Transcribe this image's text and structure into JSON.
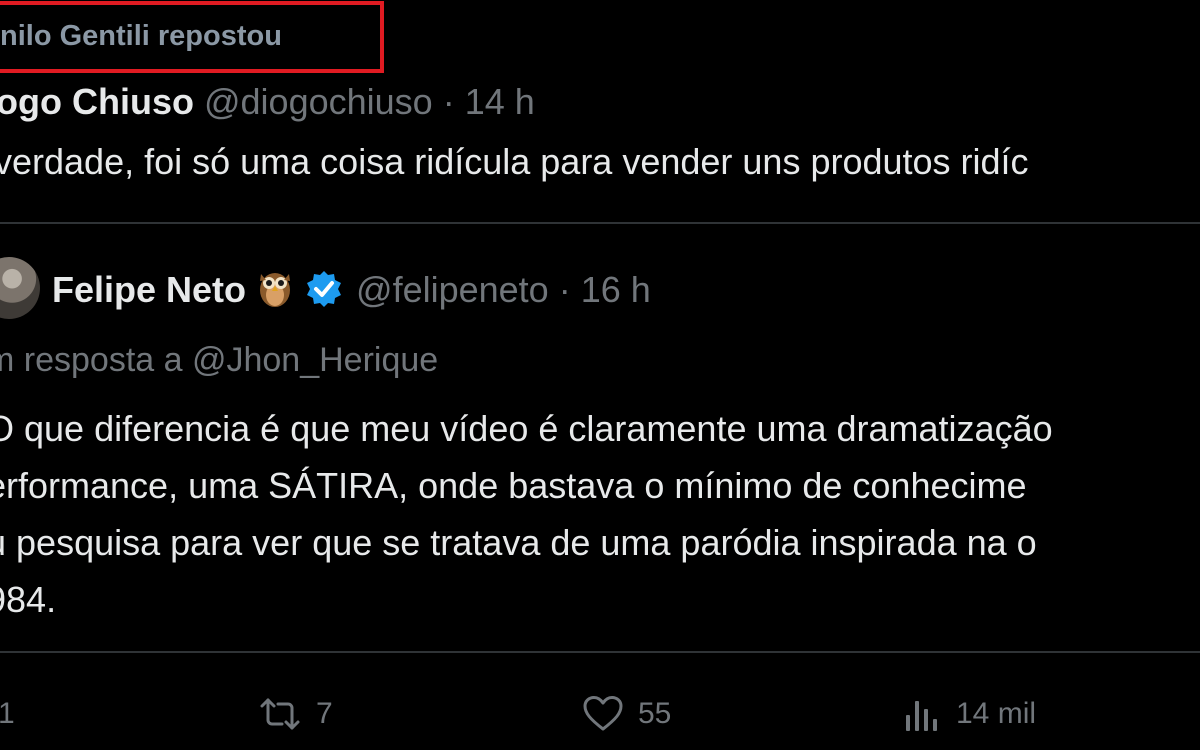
{
  "repost": {
    "text": "nilo Gentili repostou"
  },
  "tweet": {
    "author_name": "ogo Chiuso",
    "author_handle": "@diogochiuso",
    "separator": " · ",
    "time": "14 h",
    "text": "verdade, foi só uma coisa ridícula para vender uns produtos ridíc"
  },
  "quote": {
    "author_name": "Felipe Neto",
    "author_handle": "@felipeneto",
    "separator": " · ",
    "time": "16 h",
    "reply_to": "m resposta a @Jhon_Herique",
    "lines": [
      "O que diferencia é que meu vídeo é claramente uma dramatização",
      "erformance, uma SÁTIRA, onde bastava o mínimo de conhecime",
      "u pesquisa para ver que se tratava de uma paródia inspirada na o",
      "984."
    ]
  },
  "actions": {
    "reply_count": "1",
    "repost_count": "7",
    "like_count": "55",
    "views_count": "14 mil"
  },
  "colors": {
    "background": "#000000",
    "text": "#e7e9ea",
    "muted": "#71767b",
    "highlight_box": "#e01b22",
    "verified": "#1d9bf0"
  },
  "icons": [
    "owl-emoji-icon",
    "verified-badge-icon",
    "reply-icon",
    "repost-icon",
    "like-heart-icon",
    "views-chart-icon"
  ]
}
